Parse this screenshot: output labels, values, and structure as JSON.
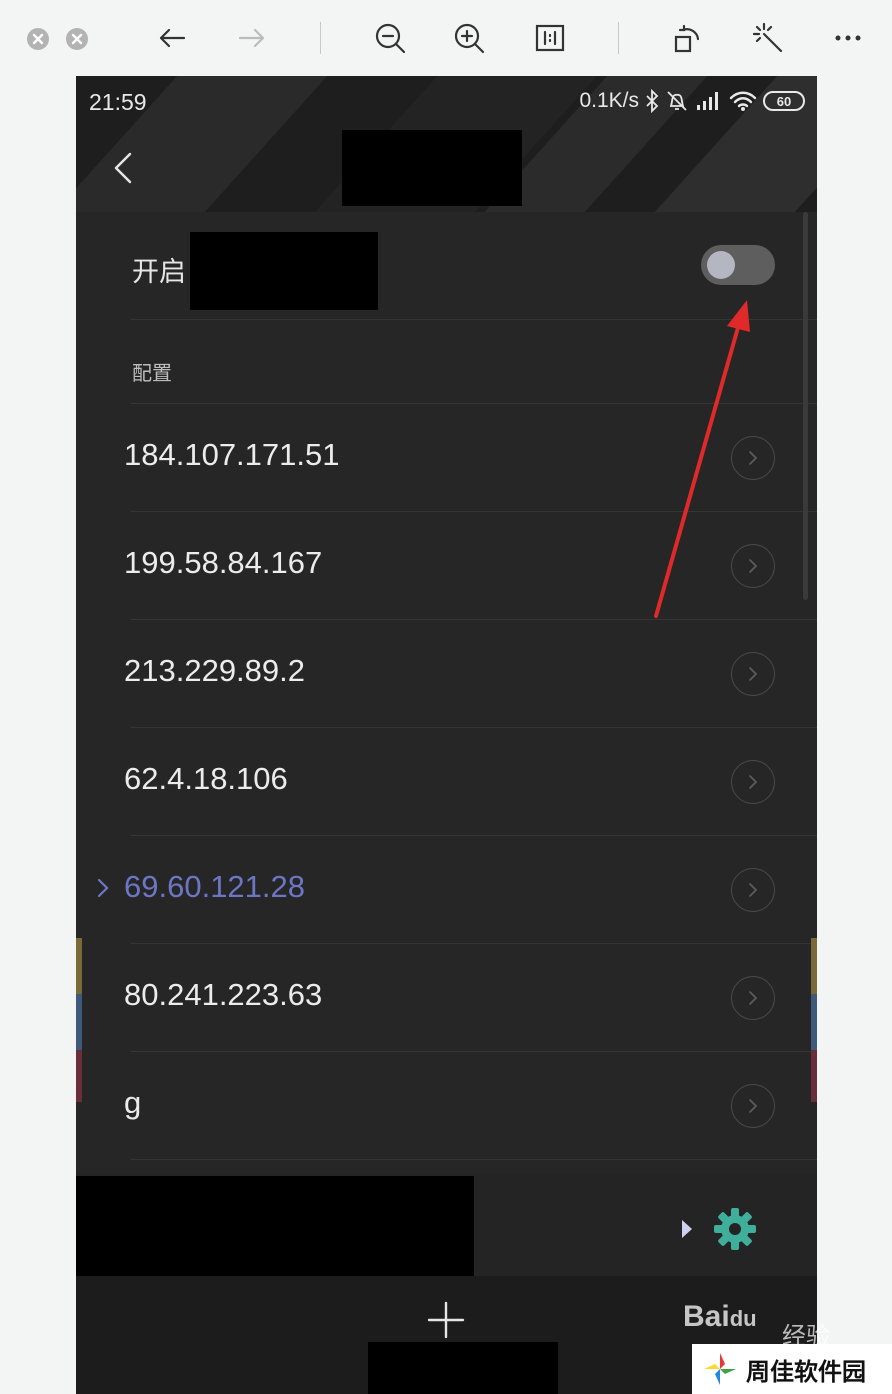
{
  "status": {
    "time": "21:59",
    "speed": "0.1K/s",
    "battery": "60"
  },
  "toggle": {
    "label": "开启",
    "state": "off"
  },
  "section": {
    "title": "配置"
  },
  "servers": [
    {
      "ip": "184.107.171.51",
      "selected": false
    },
    {
      "ip": "199.58.84.167",
      "selected": false
    },
    {
      "ip": "213.229.89.2",
      "selected": false
    },
    {
      "ip": "62.4.18.106",
      "selected": false
    },
    {
      "ip": "69.60.121.28",
      "selected": true
    },
    {
      "ip": "80.241.223.63",
      "selected": false
    },
    {
      "ip": "g",
      "selected": false
    }
  ],
  "watermark": {
    "baidu": "Bai",
    "baidu_du": "du",
    "baidu_suffix": "经验",
    "site": "周佳软件园"
  },
  "colors": {
    "accent": "#6d76c4",
    "gear": "#3fae9a",
    "annotation": "#e02a2a"
  },
  "icons": {
    "back": "chevron-left-icon",
    "row_action": "chevron-right-icon",
    "settings": "gear-icon",
    "add": "plus-icon"
  }
}
